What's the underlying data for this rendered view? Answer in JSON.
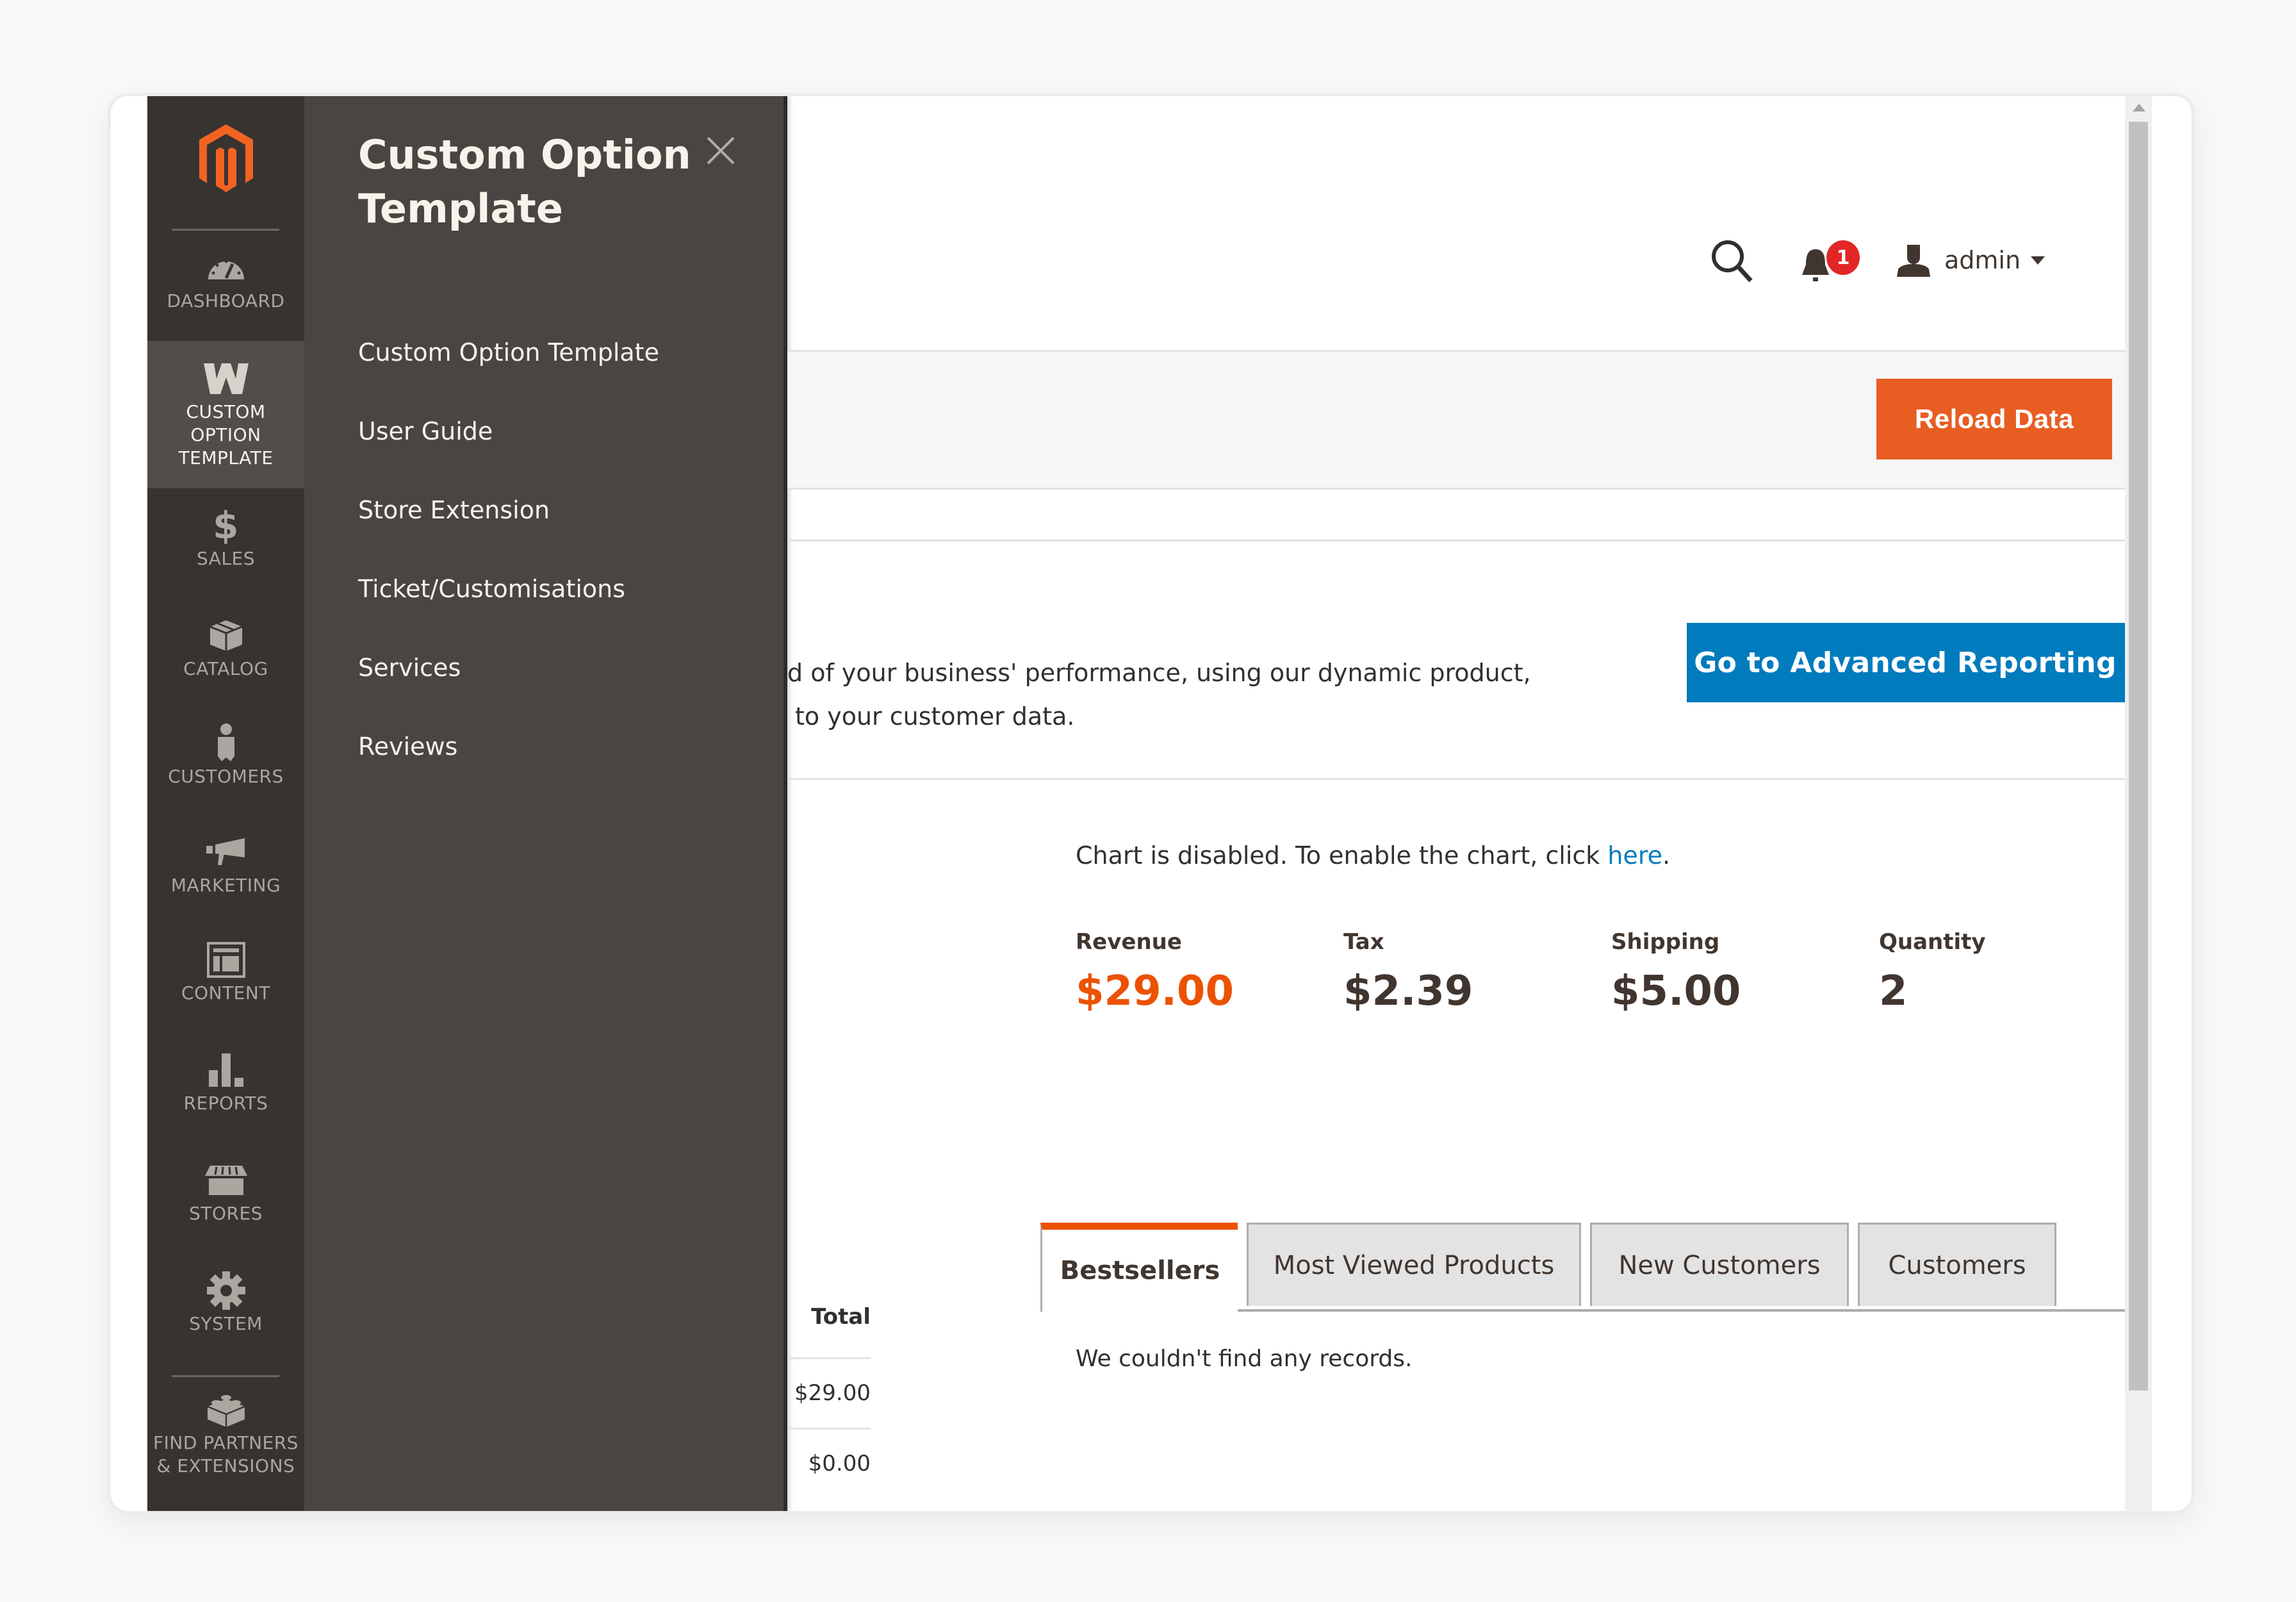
{
  "nav": {
    "logo": "magento-logo",
    "items": [
      {
        "label": "DASHBOARD",
        "icon": "dashboard-gauge-icon",
        "active": false
      },
      {
        "label": "CUSTOM OPTION TEMPLATE",
        "icon": "custom-option-w-icon",
        "active": true
      },
      {
        "label": "SALES",
        "icon": "dollar-icon",
        "active": false
      },
      {
        "label": "CATALOG",
        "icon": "box-icon",
        "active": false
      },
      {
        "label": "CUSTOMERS",
        "icon": "person-icon",
        "active": false
      },
      {
        "label": "MARKETING",
        "icon": "megaphone-icon",
        "active": false
      },
      {
        "label": "CONTENT",
        "icon": "layout-icon",
        "active": false
      },
      {
        "label": "REPORTS",
        "icon": "bar-chart-icon",
        "active": false
      },
      {
        "label": "STORES",
        "icon": "storefront-icon",
        "active": false
      },
      {
        "label": "SYSTEM",
        "icon": "gear-icon",
        "active": false
      },
      {
        "label": "FIND PARTNERS & EXTENSIONS",
        "icon": "lego-brick-icon",
        "active": false
      }
    ]
  },
  "panel": {
    "title": "Custom Option Template",
    "close_icon": "close-icon",
    "menu": [
      "Custom Option Template",
      "User Guide",
      "Store Extension",
      "Ticket/Customisations",
      "Services",
      "Reviews"
    ]
  },
  "header": {
    "search_icon": "search-icon",
    "notifications_count": "1",
    "user_name": "admin"
  },
  "actions": {
    "reload_label": "Reload Data"
  },
  "advanced": {
    "text_line1": "d of your business' performance, using our dynamic product,",
    "text_line2": "to your customer data.",
    "button_label": "Go to Advanced Reporting"
  },
  "chart": {
    "message": "Chart is disabled. To enable the chart, click ",
    "link": "here",
    "suffix": "."
  },
  "totals": [
    {
      "label": "Revenue",
      "value": "$29.00"
    },
    {
      "label": "Tax",
      "value": "$2.39"
    },
    {
      "label": "Shipping",
      "value": "$5.00"
    },
    {
      "label": "Quantity",
      "value": "2"
    }
  ],
  "left_table": {
    "header": "Total",
    "rows": [
      "$29.00",
      "$0.00"
    ]
  },
  "tabs": [
    {
      "label": "Bestsellers",
      "active": true
    },
    {
      "label": "Most Viewed Products",
      "active": false
    },
    {
      "label": "New Customers",
      "active": false
    },
    {
      "label": "Customers",
      "active": false
    }
  ],
  "tab_content": {
    "empty_message": "We couldn't find any records."
  },
  "colors": {
    "brand_orange": "#eb5202",
    "button_blue": "#007bbd",
    "nav_bg": "#373330",
    "panel_bg": "#4a4542"
  }
}
